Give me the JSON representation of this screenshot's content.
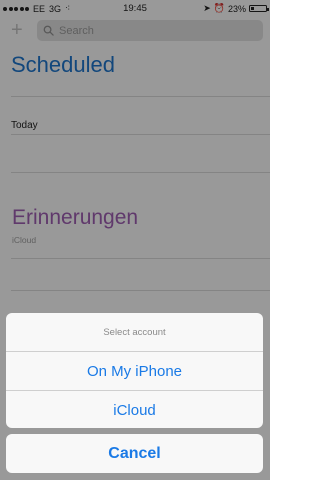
{
  "status_bar": {
    "carrier": "EE",
    "network": "3G",
    "time": "19:45",
    "battery": "23%",
    "battery_level": 0.23
  },
  "search": {
    "placeholder": "Search"
  },
  "lists": {
    "scheduled": {
      "title": "Scheduled",
      "section": "Today"
    },
    "erinnerungen": {
      "title": "Erinnerungen",
      "account": "iCloud"
    }
  },
  "action_sheet": {
    "title": "Select account",
    "options": [
      "On My iPhone",
      "iCloud"
    ],
    "cancel": "Cancel"
  },
  "colors": {
    "accent": "#1a7ae6",
    "scheduled": "#1e73c8",
    "erinnerungen": "#9b5cae"
  }
}
